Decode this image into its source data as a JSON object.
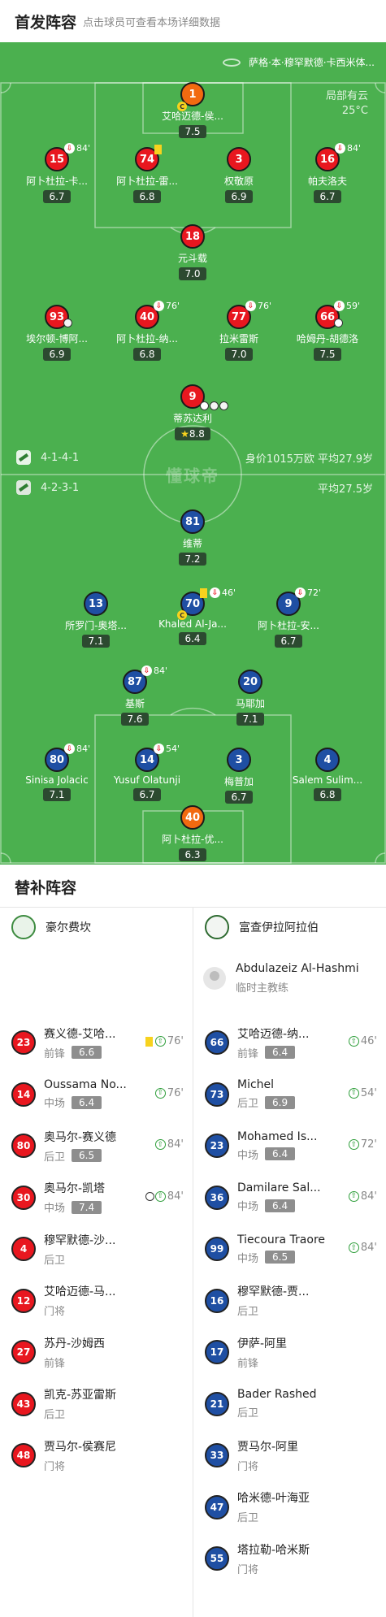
{
  "header": {
    "title": "首发阵容",
    "subtitle": "点击球员可查看本场详细数据"
  },
  "pitch": {
    "referee": "萨格·本·穆罕默德·卡西米体...",
    "weather": {
      "condition": "局部有云",
      "temp": "25°C"
    },
    "watermark": "懂球帝",
    "home_formation": "4-1-4-1",
    "away_formation": "4-2-3-1",
    "home_value_avg": "身价1015万欧 平均27.9岁",
    "away_avg": "平均27.5岁",
    "home_players": [
      {
        "num": "1",
        "name": "艾哈迈德-侯...",
        "rating": "7.5"
      },
      {
        "num": "15",
        "name": "阿卜杜拉-卡...",
        "rating": "6.7",
        "sub": "84'"
      },
      {
        "num": "74",
        "name": "阿卜杜拉-雷...",
        "rating": "6.8"
      },
      {
        "num": "3",
        "name": "权敬原",
        "rating": "6.9"
      },
      {
        "num": "16",
        "name": "帕夫洛夫",
        "rating": "6.7",
        "sub": "84'"
      },
      {
        "num": "18",
        "name": "元斗载",
        "rating": "7.0"
      },
      {
        "num": "93",
        "name": "埃尔顿-博阿...",
        "rating": "6.9"
      },
      {
        "num": "40",
        "name": "阿卜杜拉-纳...",
        "rating": "6.8",
        "sub": "76'"
      },
      {
        "num": "77",
        "name": "拉米雷斯",
        "rating": "7.0",
        "sub": "76'"
      },
      {
        "num": "66",
        "name": "哈姆丹-胡德洛",
        "rating": "7.5",
        "sub": "59'"
      },
      {
        "num": "9",
        "name": "蒂苏达利",
        "rating": "8.8"
      }
    ],
    "away_players": [
      {
        "num": "81",
        "name": "维蒂",
        "rating": "7.2"
      },
      {
        "num": "13",
        "name": "所罗门-奥塔...",
        "rating": "7.1"
      },
      {
        "num": "70",
        "name": "Khaled Al-Ja...",
        "rating": "6.4",
        "sub": "46'"
      },
      {
        "num": "9",
        "name": "阿卜杜拉-安...",
        "rating": "6.7",
        "sub": "72'"
      },
      {
        "num": "87",
        "name": "基斯",
        "rating": "7.6",
        "sub": "84'"
      },
      {
        "num": "20",
        "name": "马耶加",
        "rating": "7.1"
      },
      {
        "num": "80",
        "name": "Sinisa Jolacic",
        "rating": "7.1",
        "sub": "84'"
      },
      {
        "num": "14",
        "name": "Yusuf Olatunji",
        "rating": "6.7",
        "sub": "54'"
      },
      {
        "num": "3",
        "name": "梅普加",
        "rating": "6.7"
      },
      {
        "num": "4",
        "name": "Salem Sulim...",
        "rating": "6.8"
      },
      {
        "num": "40",
        "name": "阿卜杜拉-优...",
        "rating": "6.3"
      }
    ],
    "captain_mark": "C"
  },
  "subs": {
    "title": "替补阵容",
    "home_team": "豪尔费坎",
    "away_team": "富查伊拉阿拉伯",
    "coach": {
      "name": "Abdulazeiz Al-Hashmi",
      "role": "临时主教练"
    },
    "home": [
      {
        "num": "23",
        "name": "赛义德-艾哈...",
        "pos": "前锋",
        "rating": "6.6",
        "time": "76'"
      },
      {
        "num": "14",
        "name": "Oussama No...",
        "pos": "中场",
        "rating": "6.4",
        "time": "76'"
      },
      {
        "num": "80",
        "name": "奥马尔-赛义德",
        "pos": "后卫",
        "rating": "6.5",
        "time": "84'"
      },
      {
        "num": "30",
        "name": "奥马尔-凯塔",
        "pos": "中场",
        "rating": "7.4",
        "time": "84'"
      },
      {
        "num": "4",
        "name": "穆罕默德-沙...",
        "pos": "后卫"
      },
      {
        "num": "12",
        "name": "艾哈迈德-马...",
        "pos": "门将"
      },
      {
        "num": "27",
        "name": "苏丹-沙姆西",
        "pos": "前锋"
      },
      {
        "num": "43",
        "name": "凯克-苏亚雷斯",
        "pos": "后卫"
      },
      {
        "num": "48",
        "name": "贾马尔-侯赛尼",
        "pos": "门将"
      }
    ],
    "away": [
      {
        "num": "66",
        "name": "艾哈迈德-纳...",
        "pos": "前锋",
        "rating": "6.4",
        "time": "46'"
      },
      {
        "num": "73",
        "name": "Michel",
        "pos": "后卫",
        "rating": "6.9",
        "time": "54'"
      },
      {
        "num": "23",
        "name": "Mohamed Is...",
        "pos": "中场",
        "rating": "6.4",
        "time": "72'"
      },
      {
        "num": "36",
        "name": "Damilare Sal...",
        "pos": "中场",
        "rating": "6.4",
        "time": "84'"
      },
      {
        "num": "99",
        "name": "Tiecoura Traore",
        "pos": "中场",
        "rating": "6.5",
        "time": "84'"
      },
      {
        "num": "16",
        "name": "穆罕默德-贾...",
        "pos": "后卫"
      },
      {
        "num": "17",
        "name": "伊萨-阿里",
        "pos": "前锋"
      },
      {
        "num": "21",
        "name": "Bader Rashed",
        "pos": "后卫"
      },
      {
        "num": "33",
        "name": "贾马尔-阿里",
        "pos": "门将"
      },
      {
        "num": "47",
        "name": "哈米德-叶海亚",
        "pos": "后卫"
      },
      {
        "num": "55",
        "name": "塔拉勒-哈米斯",
        "pos": "门将"
      }
    ]
  },
  "colors": {
    "home": "#e8171f",
    "away": "#1f4fa3",
    "keeper": "#f26a10",
    "pitch": "#4bb04f"
  }
}
